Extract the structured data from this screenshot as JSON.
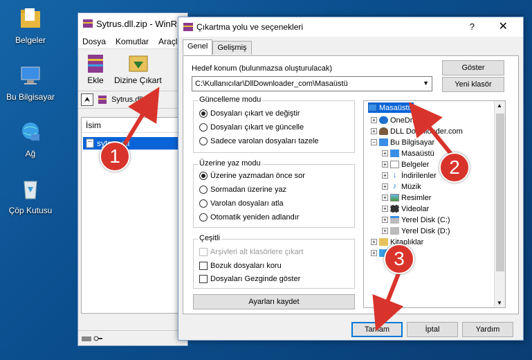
{
  "desktop": {
    "icons": [
      {
        "label": "Belgeler",
        "icon": "folder-icon"
      },
      {
        "label": "Bu Bilgisayar",
        "icon": "computer-icon"
      },
      {
        "label": "Ağ",
        "icon": "network-icon"
      },
      {
        "label": "Çöp Kutusu",
        "icon": "recycle-bin-icon"
      }
    ]
  },
  "winrar": {
    "title": "Sytrus.dll.zip - WinR",
    "menu": [
      "Dosya",
      "Komutlar",
      "Araçla"
    ],
    "toolbar": {
      "add": "Ekle",
      "extract": "Dizine Çıkart"
    },
    "path": "Sytrus.dll.z",
    "list_header": "İsim",
    "file": "sytrus.dll"
  },
  "dialog": {
    "title": "Çıkartma yolu ve seçenekleri",
    "help": "?",
    "close": "✕",
    "tabs": [
      "Genel",
      "Gelişmiş"
    ],
    "dest_label": "Hedef konum (bulunmazsa oluşturulacak)",
    "dest_value": "C:\\Kullanıcılar\\DllDownloader_com\\Masaüstü",
    "show_btn": "Göster",
    "new_folder_btn": "Yeni klasör",
    "update_group": "Güncelleme modu",
    "update_opts": [
      "Dosyaları çıkart ve değiştir",
      "Dosyaları çıkart ve güncelle",
      "Sadece varolan dosyaları tazele"
    ],
    "overwrite_group": "Üzerine yaz modu",
    "overwrite_opts": [
      "Üzerine yazmadan önce sor",
      "Sormadan üzerine yaz",
      "Varolan dosyaları atla",
      "Otomatik yeniden adlandır"
    ],
    "misc_group": "Çeşitli",
    "misc_opts": [
      "Arşivleri alt klasörlere çıkart",
      "Bozuk dosyaları koru",
      "Dosyaları Gezginde göster"
    ],
    "save_btn": "Ayarları kaydet",
    "tree": [
      {
        "label": "Masaüstü",
        "level": 0,
        "selected": true
      },
      {
        "label": "OneDrive",
        "level": 1
      },
      {
        "label": "DLL Downloader.com",
        "level": 1
      },
      {
        "label": "Bu Bilgisayar",
        "level": 1
      },
      {
        "label": "Masaüstü",
        "level": 2
      },
      {
        "label": "Belgeler",
        "level": 2
      },
      {
        "label": "İndirilenler",
        "level": 2
      },
      {
        "label": "Müzik",
        "level": 2
      },
      {
        "label": "Resimler",
        "level": 2
      },
      {
        "label": "Videolar",
        "level": 2
      },
      {
        "label": "Yerel Disk (C:)",
        "level": 2
      },
      {
        "label": "Yerel Disk (D:)",
        "level": 2
      },
      {
        "label": "Kitaplıklar",
        "level": 1
      },
      {
        "label": "",
        "level": 1
      }
    ],
    "ok_btn": "Tamam",
    "cancel_btn": "İptal",
    "help_btn": "Yardım"
  },
  "annotations": {
    "step1": "1",
    "step2": "2",
    "step3": "3",
    "color": "#d9342b"
  }
}
